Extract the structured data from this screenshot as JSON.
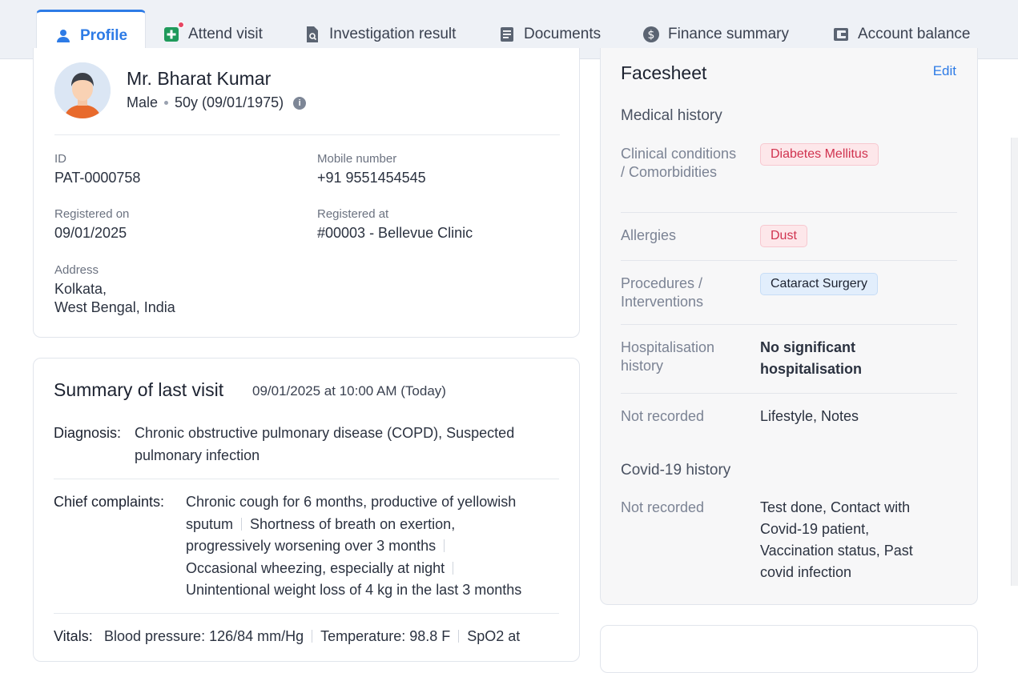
{
  "tabs": [
    {
      "label": "Profile",
      "icon": "person-icon",
      "active": true
    },
    {
      "label": "Attend visit",
      "icon": "medical-plus-icon",
      "badge": true
    },
    {
      "label": "Investigation result",
      "icon": "search-document-icon"
    },
    {
      "label": "Documents",
      "icon": "document-icon"
    },
    {
      "label": "Finance summary",
      "icon": "dollar-circle-icon"
    },
    {
      "label": "Account balance",
      "icon": "wallet-icon"
    }
  ],
  "patient": {
    "name": "Mr. Bharat Kumar",
    "gender": "Male",
    "age_dob": "50y (09/01/1975)",
    "fields": {
      "id_label": "ID",
      "id_value": "PAT-0000758",
      "mobile_label": "Mobile number",
      "mobile_value": "+91 9551454545",
      "registered_on_label": "Registered on",
      "registered_on_value": "09/01/2025",
      "registered_at_label": "Registered at",
      "registered_at_value": "#00003 - Bellevue Clinic",
      "address_label": "Address",
      "address_line1": "Kolkata,",
      "address_line2": "West Bengal, India"
    }
  },
  "summary": {
    "title": "Summary of last visit",
    "date": "09/01/2025 at 10:00 AM (Today)",
    "diagnosis_label": "Diagnosis:",
    "diagnosis_line1": "Chronic obstructive pulmonary disease (COPD),  Suspected",
    "diagnosis_line2": "pulmonary infection",
    "complaints_label": "Chief complaints:",
    "complaints": [
      "Chronic cough for 6 months, productive of yellowish",
      "sputum",
      "Shortness of breath on exertion,",
      "progressively worsening over 3 months",
      "Occasional wheezing, especially at night",
      "Unintentional weight loss of 4 kg in the last 3 months"
    ],
    "vitals_label": "Vitals:",
    "vitals": {
      "bp_label": "Blood pressure:",
      "bp_value": "126/84 mm/Hg",
      "temp_label": "Temperature:",
      "temp_value": "98.8 F",
      "spo2_label": "SpO2 at"
    }
  },
  "facesheet": {
    "title": "Facesheet",
    "edit_label": "Edit",
    "medical_history_title": "Medical history",
    "clinical_label": "Clinical conditions / Comorbidities",
    "clinical_chip": "Diabetes Mellitus",
    "allergies_label": "Allergies",
    "allergies_chip": "Dust",
    "procedures_label": "Procedures / Interventions",
    "procedures_chip": "Cataract Surgery",
    "hosp_label": "Hospitalisation history",
    "hosp_value": "No significant hospitalisation",
    "not_recorded_label": "Not recorded",
    "not_recorded_value": "Lifestyle, Notes",
    "covid_title": "Covid-19 history",
    "covid_not_recorded_label": "Not recorded",
    "covid_not_recorded_value": "Test done, Contact with Covid-19 patient, Vaccination status, Past covid infection"
  },
  "colors": {
    "accent": "#2d7be6",
    "chip_red_bg": "#fde7ea",
    "chip_red_text": "#d0334f",
    "chip_blue_bg": "#e2eefc",
    "badge_dot": "#e64562"
  }
}
